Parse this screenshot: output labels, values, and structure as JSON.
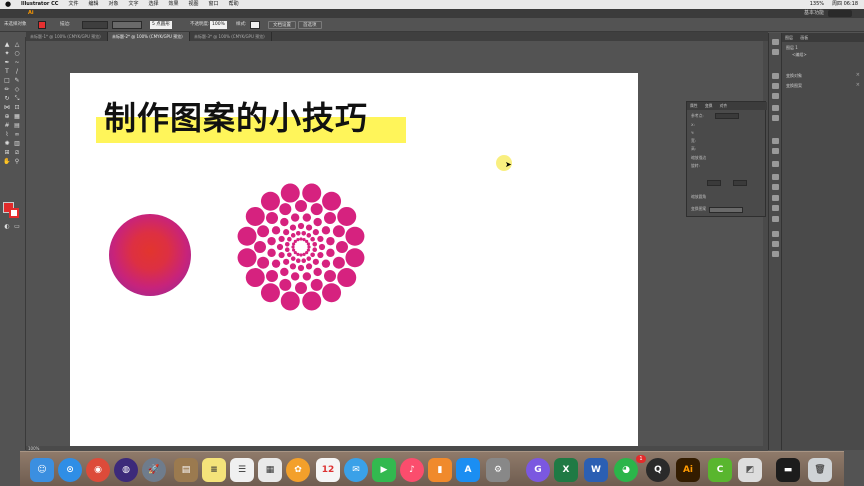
{
  "menubar": {
    "apple_icon": "apple-icon",
    "app_name": "Illustrator CC",
    "items": [
      "文件",
      "编辑",
      "对象",
      "文字",
      "选择",
      "效果",
      "视图",
      "窗口",
      "帮助"
    ],
    "status_right": [
      "135%",
      "周四 06:18"
    ]
  },
  "appbar": {
    "logo": "Ai",
    "workspace_label": "基本功能"
  },
  "controlbar": {
    "selection_label": "未选择对象",
    "stroke_label": "描边:",
    "brush_value": "5 点圆形",
    "opacity_label": "不透明度:",
    "opacity_value": "100%",
    "style_label": "样式:",
    "doc_setup_button": "文档设置",
    "preferences_button": "首选项"
  },
  "tabs": [
    {
      "label": "未标题-1* @ 100% (CMYK/GPU 预览)",
      "active": false
    },
    {
      "label": "未标题-2* @ 100% (CMYK/GPU 预览)",
      "active": true
    },
    {
      "label": "未标题-3* @ 100% (CMYK/GPU 预览)",
      "active": false
    }
  ],
  "artboard": {
    "title": "制作图案的小技巧",
    "highlight_color": "#fff55a",
    "dot_color": "#d6227f",
    "gradient_colors": [
      "#e2352e",
      "#c8237a",
      "#8a2a9e"
    ]
  },
  "float_panel": {
    "tabs": [
      "属性",
      "变换",
      "对齐"
    ],
    "rows": [
      "参考点:",
      "X:",
      "Y:",
      "宽:",
      "高:",
      "旋转:",
      "缩放描边",
      "缩放圆角",
      "变换图案"
    ]
  },
  "layers_panel": {
    "tabs": [
      "图层",
      "画板"
    ],
    "layer_name": "图层 1",
    "sub_item": "<编组>",
    "options": [
      "变换对象",
      "变换图案"
    ]
  },
  "status": {
    "zoom": "100%"
  },
  "dock": {
    "badge_count": "1",
    "apps": [
      "finder",
      "safari",
      "chrome",
      "siri",
      "launchpad",
      "notes",
      "calendar",
      "mail",
      "word",
      "excel",
      "illustrator",
      "wechat",
      "trash"
    ]
  }
}
